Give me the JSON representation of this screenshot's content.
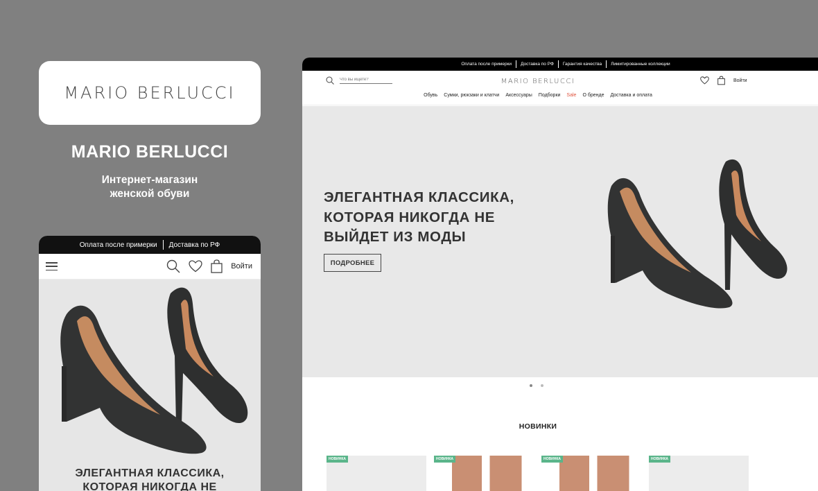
{
  "brand": {
    "logo_text": "MARIO BERLUCCI",
    "title": "MARIO BERLUCCI",
    "subtitle_line1": "Интернет-магазин",
    "subtitle_line2": "женской обуви"
  },
  "mobile": {
    "topbar": [
      "Оплата после примерки",
      "Доставка по РФ"
    ],
    "login": "Войти",
    "headline_line1": "ЭЛЕГАНТНАЯ КЛАССИКА,",
    "headline_line2": "КОТОРАЯ НИКОГДА НЕ"
  },
  "desktop": {
    "topbar": [
      "Оплата после примерки",
      "Доставка по РФ",
      "Гарантия качества",
      "Лимитированные коллекции"
    ],
    "search_placeholder": "Что вы ищете?",
    "logo": "MARIO BERLUCCI",
    "login": "Войти",
    "nav": [
      "Обувь",
      "Сумки, рюкзаки и клатчи",
      "Аксессуары",
      "Подборки",
      "Sale",
      "О бренде",
      "Доставка и оплата"
    ],
    "hero": {
      "line1": "ЭЛЕГАНТНАЯ КЛАССИКА,",
      "line2": "КОТОРАЯ НИКОГДА НЕ",
      "line3": "ВЫЙДЕТ ИЗ МОДЫ",
      "button": "ПОДРОБНЕЕ"
    },
    "slider_pages": 2,
    "slider_active": 1,
    "section_title": "НОВИНКИ",
    "badge": "НОВИНКА",
    "colors": {
      "sale": "#e0533d",
      "badge": "#5ab58a",
      "background": "#808080"
    }
  }
}
